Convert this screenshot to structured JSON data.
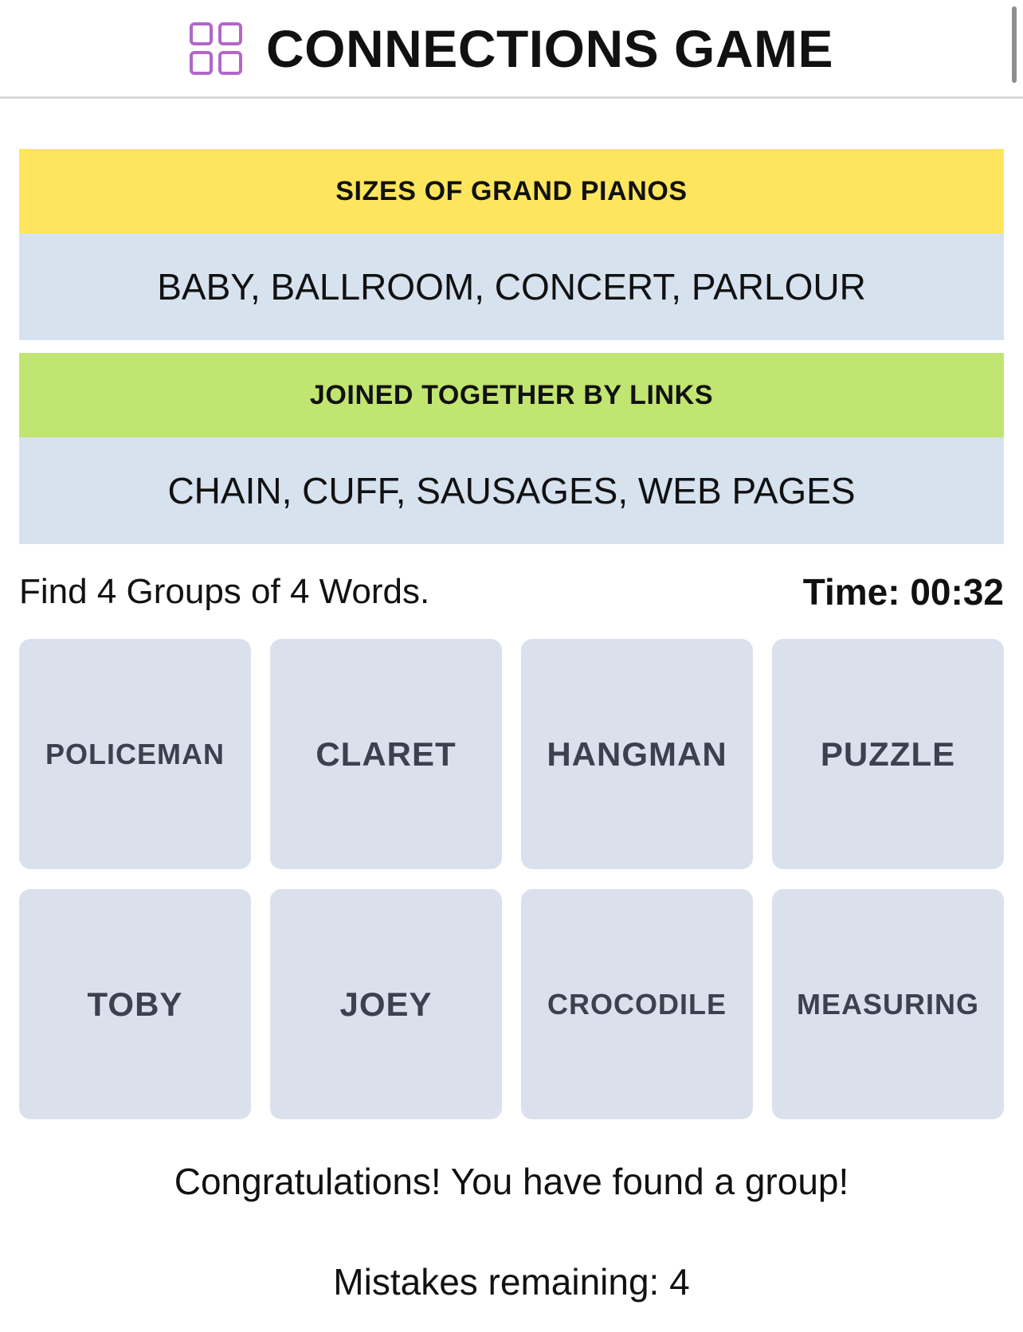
{
  "header": {
    "title": "CONNECTIONS GAME",
    "icon": "grid-icon",
    "icon_color": "#b366c9"
  },
  "solved_groups": [
    {
      "name": "SIZES OF GRAND PIANOS",
      "words": "BABY, BALLROOM, CONCERT, PARLOUR",
      "color": "#fde55e"
    },
    {
      "name": "JOINED TOGETHER BY LINKS",
      "words": "CHAIN, CUFF, SAUSAGES, WEB PAGES",
      "color": "#c1e571"
    }
  ],
  "instructions": "Find 4 Groups of 4 Words.",
  "timer": "Time: 00:32",
  "tiles": [
    "POLICEMAN",
    "CLARET",
    "HANGMAN",
    "PUZZLE",
    "TOBY",
    "JOEY",
    "CROCODILE",
    "MEASURING"
  ],
  "message": "Congratulations! You have found a group!",
  "mistakes": "Mistakes remaining: 4",
  "colors": {
    "tile_bg": "#dbe1ec",
    "tile_text": "#3c4150",
    "group_body_bg": "#d7e2ef"
  }
}
